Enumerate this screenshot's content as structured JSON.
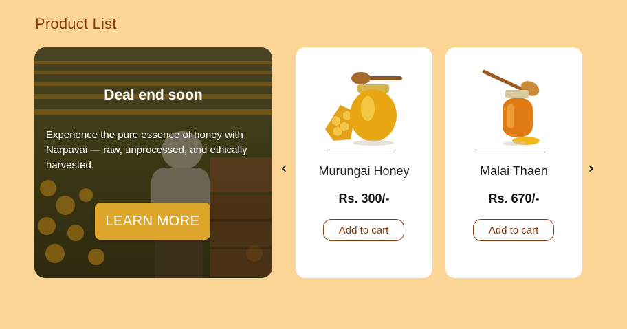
{
  "page": {
    "title": "Product List"
  },
  "promo": {
    "title": "Deal end soon",
    "description": "Experience the pure essence of honey with Narpavai — raw, unprocessed, and ethically harvested.",
    "button_label": "LEARN MORE"
  },
  "carousel": {
    "prev_icon": "‹",
    "next_icon": "›"
  },
  "products": [
    {
      "name": "Murungai Honey",
      "price": "Rs. 300/-",
      "button_label": "Add to cart",
      "image": "honey-jar-with-comb"
    },
    {
      "name": "Malai Thaen",
      "price": "Rs. 670/-",
      "button_label": "Add to cart",
      "image": "honey-jar-with-dipper"
    }
  ],
  "colors": {
    "background": "#fbd595",
    "brand_brown": "#8a3c0e",
    "button_gold": "#dfa62c"
  }
}
